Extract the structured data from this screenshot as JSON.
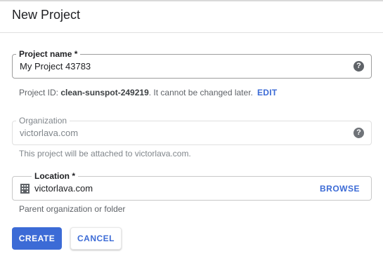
{
  "dialog": {
    "title": "New Project"
  },
  "project_name": {
    "label": "Project name *",
    "value": "My Project 43783",
    "help_icon": "help-icon"
  },
  "project_id_hint": {
    "prefix": "Project ID: ",
    "id": "clean-sunspot-249219",
    "suffix": ". It cannot be changed later.",
    "edit_label": "EDIT"
  },
  "organization": {
    "label": "Organization",
    "value": "victorlava.com",
    "help_icon": "help-icon",
    "hint": "This project will be attached to victorlava.com."
  },
  "location": {
    "label": "Location *",
    "value": "victorlava.com",
    "icon": "building-icon",
    "browse_label": "BROWSE",
    "hint": "Parent organization or folder"
  },
  "actions": {
    "create_label": "CREATE",
    "cancel_label": "CANCEL"
  },
  "colors": {
    "accent": "#3c6bd6",
    "text_primary": "#202124",
    "text_secondary": "#5f6368",
    "text_disabled": "#80868b"
  }
}
